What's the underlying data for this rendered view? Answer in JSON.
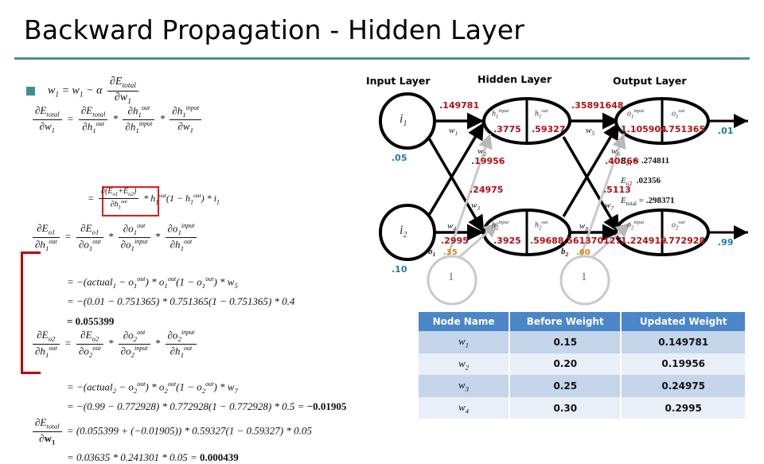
{
  "slide": {
    "title": "Backward Propagation - Hidden Layer",
    "accent_teal": "#4e8f96",
    "accent_red": "#b21117",
    "accent_blue": "#1f7d9c",
    "table_header_blue": "#4a86c8"
  },
  "equations": {
    "line1": "w₁ = w₁ − α ∂E_total/∂w₁",
    "line2": "∂E_total/∂w₁ = ∂E_total/∂h₁^out * ∂h₁^out/∂h₁^input * ∂h₁^input/∂w₁",
    "line3": "= ∂(E_o1+E_o2)/∂h₁^out * h₁^out(1 − h₁^out) * i₁",
    "line4": "∂E_o1/∂h₁^out = ∂E_o1/∂o₁^out * ∂o₁^out/∂o₁^input * ∂o₁^input/∂h₁^out",
    "line5": "= −(actual₁ − o₁^out) * o₁^out(1 − o₁^out) * w₅",
    "line6": "= −(0.01 − 0.751365) * 0.751365(1 − 0.751365) * 0.4",
    "line7": "= 0.055399",
    "line8": "∂E_o2/∂h₁^out = ∂E_o2/∂o₂^out * ∂o₂^out/∂o₂^input * ∂o₂^input/∂h₁^out",
    "line9": "= −(actual₂ − o₂^out) * o₂^out(1 − o₂^out) * w₇",
    "line10": "= −(0.99 − 0.772928) * 0.772928(1 − 0.772928) * 0.5 = −0.01905",
    "line11": "∂E_total/∂w₁ = (0.055399 + (−0.01905)) * 0.59327(1 − 0.59327) * 0.05",
    "line12": "= 0.03635 * 0.241301 * 0.05 = 0.000439",
    "values": {
      "o1_out": "0.751365",
      "o2_out": "0.772928",
      "actual1": "0.01",
      "actual2": "0.99",
      "w5": "0.4",
      "w7": "0.5",
      "dEo1": "0.055399",
      "dEo2": "−0.01905",
      "h1_out": "0.59327",
      "i1": "0.05",
      "sum": "0.03635",
      "deriv": "0.241301",
      "result": "0.000439"
    }
  },
  "network": {
    "layer_titles": {
      "input": "Input Layer",
      "hidden": "Hidden Layer",
      "output": "Output Layer"
    },
    "input_nodes": [
      {
        "name": "i₁",
        "value": ".05"
      },
      {
        "name": "i₂",
        "value": ".10"
      }
    ],
    "hidden_nodes": [
      {
        "in_label": "h₁ input",
        "out_label": "h₁ out",
        "in_value": ".3775",
        "out_value": ".59327"
      },
      {
        "in_label": "h₂ input",
        "out_label": "h₂ out",
        "in_value": ".3925",
        "out_value": ".59688"
      }
    ],
    "output_nodes": [
      {
        "in_label": "o₁ input",
        "out_label": "o₁ out",
        "in_value": "1.105904",
        "out_value": ".751365",
        "target": ".01"
      },
      {
        "in_label": "o₂ input",
        "out_label": "o₂ out",
        "in_value": "1.224919",
        "out_value": ".772928",
        "target": ".99"
      }
    ],
    "weights": [
      {
        "name": "w₁",
        "value": ".149781"
      },
      {
        "name": "w₂",
        "value": ".19956"
      },
      {
        "name": "w₃",
        "value": ".24975"
      },
      {
        "name": "w₄",
        "value": ".2995"
      },
      {
        "name": "w₅",
        "value": ".35891648"
      },
      {
        "name": "w₆",
        "value": ".40866"
      },
      {
        "name": "w₇",
        "value": ".5113"
      },
      {
        "name": "w₈",
        "value": ".561370127"
      }
    ],
    "biases": [
      {
        "name": "b₁",
        "value": ".35",
        "node": "1"
      },
      {
        "name": "b₂",
        "value": ".60",
        "node": "1"
      }
    ],
    "errors": [
      {
        "name": "E",
        "sub": "o1",
        "eq": "=",
        "value": ".274811"
      },
      {
        "name": "E",
        "sub": "o2",
        "eq": "",
        "value": ".02356"
      },
      {
        "name": "E",
        "sub": "total",
        "eq": "=",
        "value": ".298371"
      }
    ]
  },
  "table": {
    "headers": [
      "Node Name",
      "Before Weight",
      "Updated Weight"
    ],
    "rows": [
      {
        "name": "w₁",
        "before": "0.15",
        "updated": "0.149781"
      },
      {
        "name": "w₂",
        "before": "0.20",
        "updated": "0.19956"
      },
      {
        "name": "w₃",
        "before": "0.25",
        "updated": "0.24975"
      },
      {
        "name": "w₄",
        "before": "0.30",
        "updated": "0.2995"
      }
    ]
  }
}
